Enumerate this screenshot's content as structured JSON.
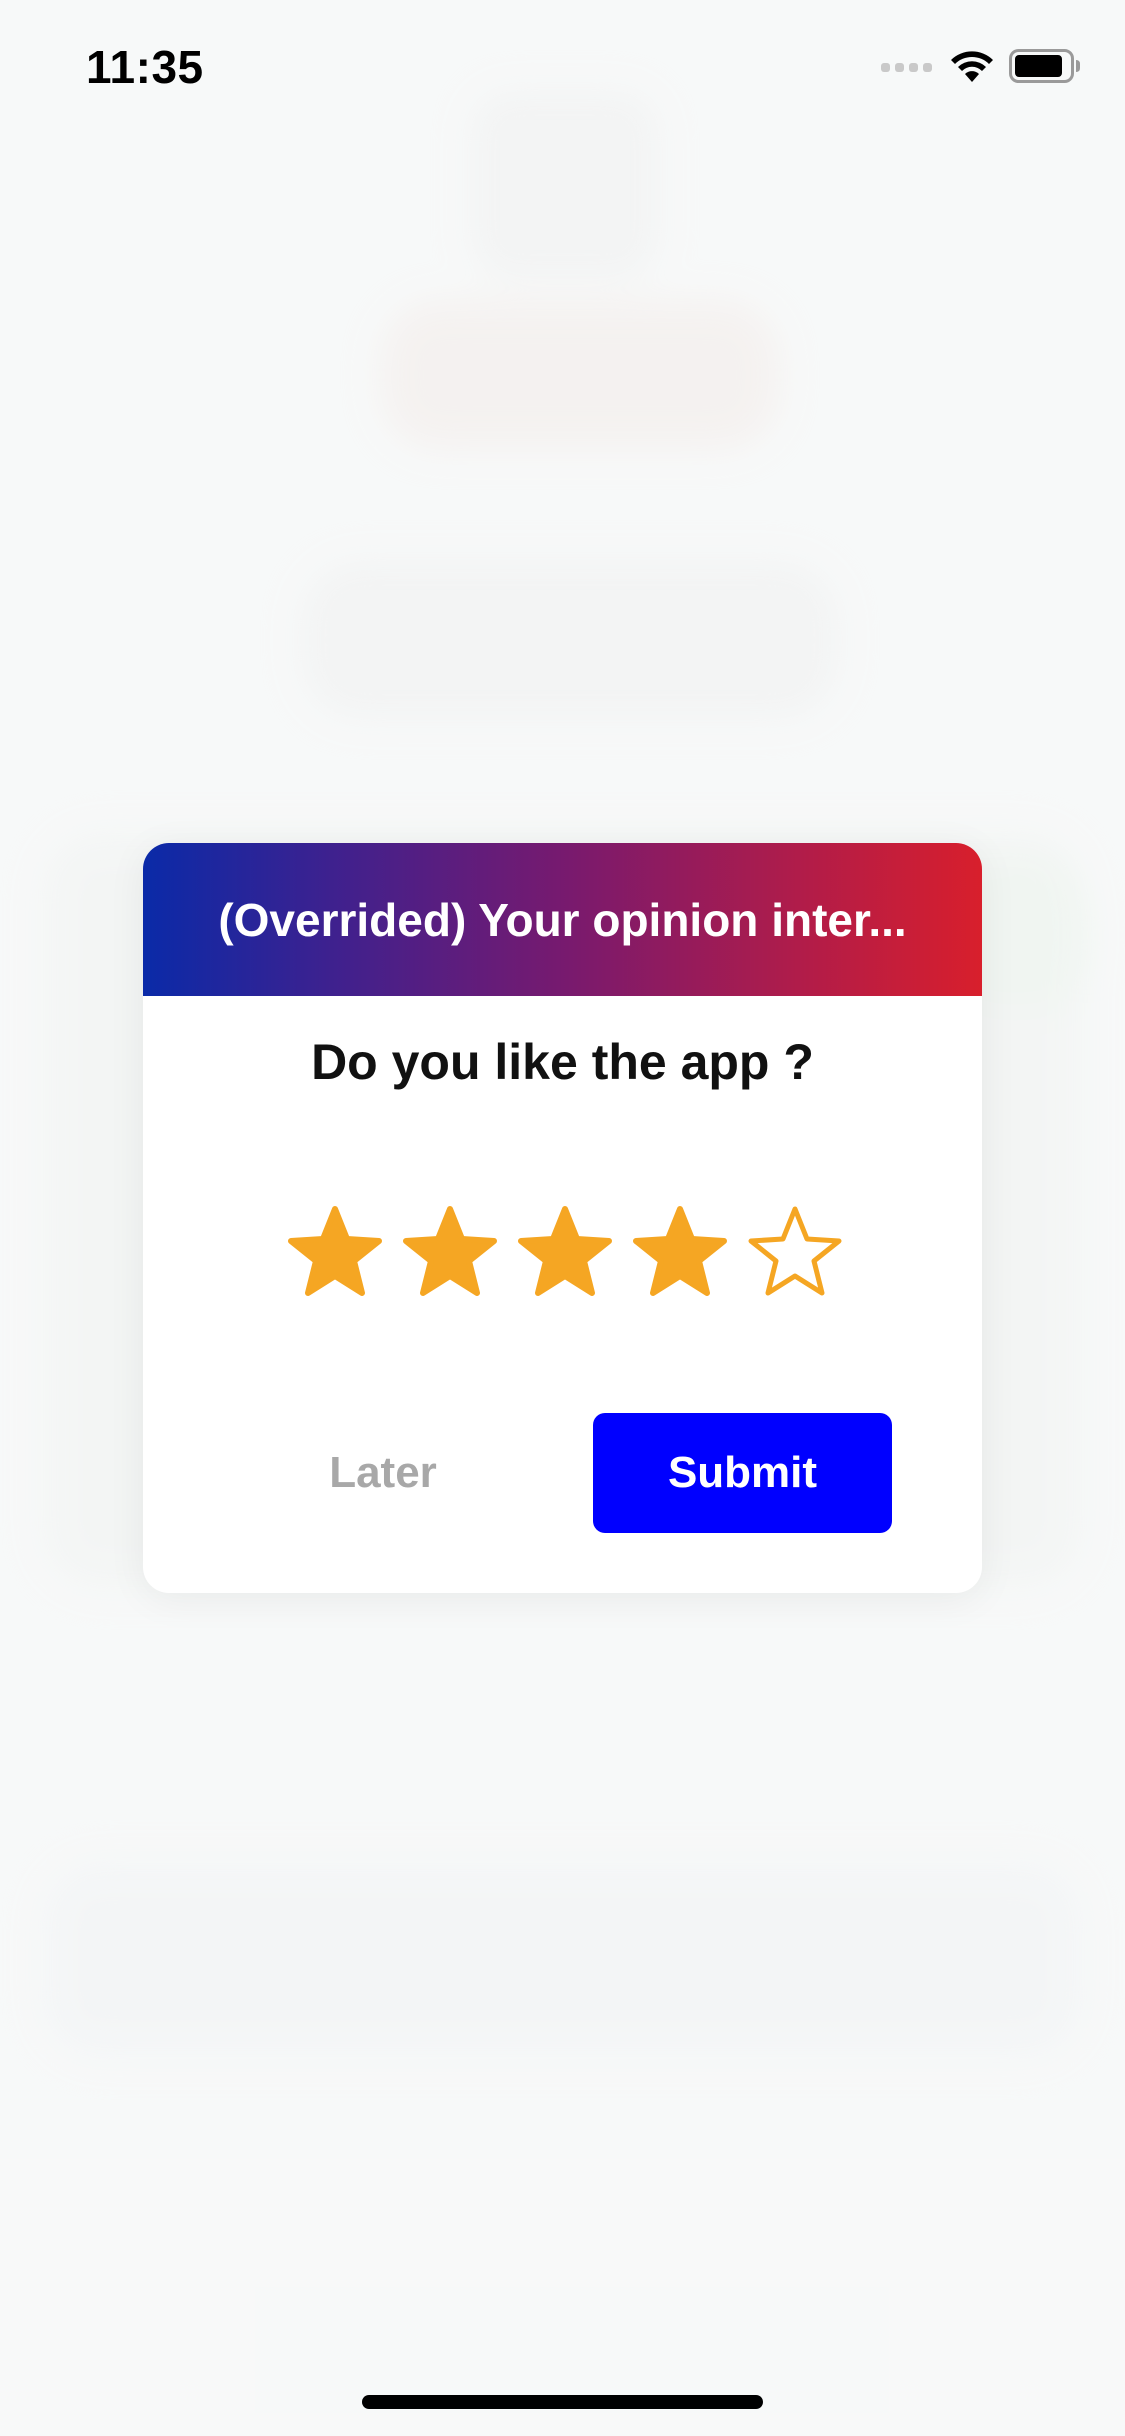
{
  "status_bar": {
    "time": "11:35"
  },
  "dialog": {
    "title": "(Overrided) Your opinion inter...",
    "question": "Do you like the app ?",
    "rating": {
      "value": 4,
      "max": 5,
      "filled_color": "#F5A623"
    },
    "later_label": "Later",
    "submit_label": "Submit"
  },
  "colors": {
    "header_gradient_start": "#0A2AA8",
    "header_gradient_end": "#D81F2C",
    "submit_button": "#0000FF",
    "later_text": "#A8A8A8"
  },
  "icons": {
    "status": [
      "cellular-signal-icon",
      "wifi-icon",
      "battery-icon"
    ],
    "rating": "star-icon"
  }
}
